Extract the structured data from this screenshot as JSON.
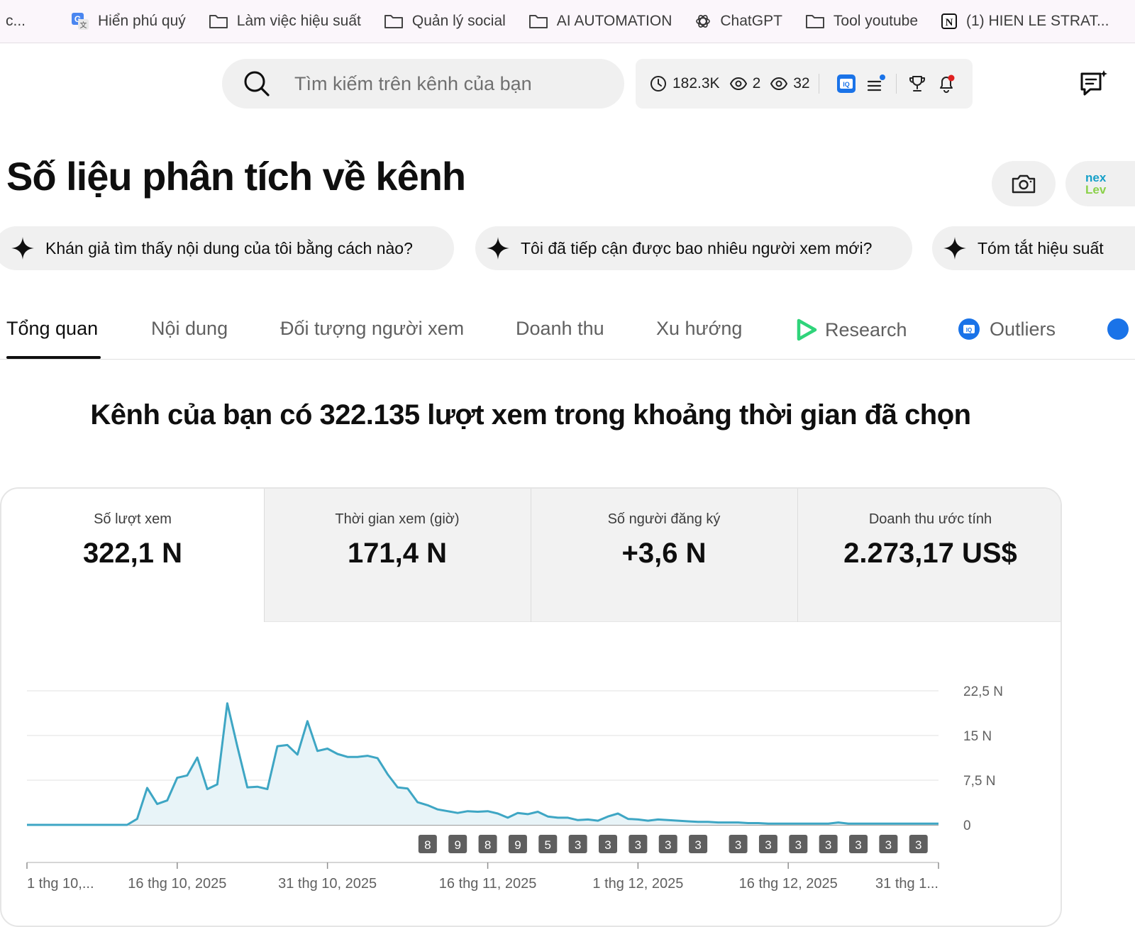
{
  "bookmarks": [
    {
      "label": "c...",
      "icon": "none"
    },
    {
      "label": "Hiển phú quý",
      "icon": "translate-icon"
    },
    {
      "label": "Làm việc hiệu suất",
      "icon": "folder-icon"
    },
    {
      "label": "Quản lý social",
      "icon": "folder-icon"
    },
    {
      "label": "AI AUTOMATION",
      "icon": "folder-icon"
    },
    {
      "label": "ChatGPT",
      "icon": "chatgpt-icon"
    },
    {
      "label": "Tool youtube",
      "icon": "folder-icon"
    },
    {
      "label": "(1) HIEN LE STRAT...",
      "icon": "notion-icon"
    }
  ],
  "search": {
    "placeholder": "Tìm kiếm trên kênh của bạn"
  },
  "extension_bar": {
    "watch_time": "182.3K",
    "views_a": "2",
    "views_b": "32"
  },
  "page": {
    "title": "Số liệu phân tích về kênh"
  },
  "suggestions": [
    "Khán giả tìm thấy nội dung của tôi bằng cách nào?",
    "Tôi đã tiếp cận được bao nhiêu người xem mới?",
    "Tóm tắt hiệu suất"
  ],
  "tabs": [
    "Tổng quan",
    "Nội dung",
    "Đối tượng người xem",
    "Doanh thu",
    "Xu hướng",
    "Research",
    "Outliers"
  ],
  "headline": "Kênh của bạn có 322.135 lượt xem trong khoảng thời gian đã chọn",
  "metrics": [
    {
      "label": "Số lượt xem",
      "value": "322,1 N"
    },
    {
      "label": "Thời gian xem (giờ)",
      "value": "171,4 N"
    },
    {
      "label": "Số người đăng ký",
      "value": "+3,6 N"
    },
    {
      "label": "Doanh thu ước tính",
      "value": "2.273,17 US$"
    }
  ],
  "colors": {
    "line": "#3ea6c4",
    "fill": "#e8f4f8",
    "accent": "#0f0f0f"
  },
  "chart_data": {
    "type": "area",
    "y_ticks": [
      "22,5 N",
      "15 N",
      "7,5 N",
      "0"
    ],
    "y_tick_values": [
      22500,
      15000,
      7500,
      0
    ],
    "ylim": [
      0,
      22500
    ],
    "x_ticks": [
      "1 thg 10,...",
      "16 thg 10, 2025",
      "31 thg 10, 2025",
      "16 thg 11, 2025",
      "1 thg 12, 2025",
      "16 thg 12, 2025",
      "31 thg 1..."
    ],
    "x_tick_days": [
      0,
      15,
      30,
      46,
      61,
      76,
      91
    ],
    "days": [
      0,
      1,
      2,
      3,
      4,
      5,
      6,
      7,
      8,
      9,
      10,
      11,
      12,
      13,
      14,
      15,
      16,
      17,
      18,
      19,
      20,
      21,
      22,
      23,
      24,
      25,
      26,
      27,
      28,
      29,
      30,
      31,
      32,
      33,
      34,
      35,
      36,
      37,
      38,
      39,
      40,
      41,
      42,
      43,
      44,
      45,
      46,
      47,
      48,
      49,
      50,
      51,
      52,
      53,
      54,
      55,
      56,
      57,
      58,
      59,
      60,
      61,
      62,
      63,
      64,
      65,
      66,
      67,
      68,
      69,
      70,
      71,
      72,
      73,
      74,
      75,
      76,
      77,
      78,
      79,
      80,
      81,
      82,
      83,
      84,
      85,
      86,
      87,
      88,
      89,
      90,
      91
    ],
    "values": [
      0,
      0,
      0,
      0,
      0,
      0,
      0,
      0,
      0,
      0,
      0,
      1000,
      6200,
      3500,
      4100,
      7900,
      8300,
      11300,
      6000,
      6800,
      20400,
      13200,
      6300,
      6400,
      6000,
      13200,
      13400,
      11800,
      17400,
      12400,
      12800,
      11900,
      11400,
      11400,
      11600,
      11200,
      8500,
      6300,
      6100,
      3800,
      3300,
      2600,
      2300,
      2000,
      2300,
      2200,
      2300,
      1900,
      1200,
      2000,
      1800,
      2200,
      1400,
      1200,
      1200,
      800,
      900,
      700,
      1400,
      1900,
      1000,
      900,
      700,
      900,
      800,
      700,
      600,
      500,
      500,
      400,
      400,
      400,
      300,
      300,
      200,
      200,
      200,
      200,
      200,
      200,
      200,
      400,
      200,
      200,
      200,
      200,
      200,
      200,
      200,
      200,
      200,
      200
    ],
    "markers": [
      {
        "day": 40,
        "label": "8"
      },
      {
        "day": 43,
        "label": "9"
      },
      {
        "day": 46,
        "label": "8"
      },
      {
        "day": 49,
        "label": "9"
      },
      {
        "day": 52,
        "label": "5"
      },
      {
        "day": 55,
        "label": "3"
      },
      {
        "day": 58,
        "label": "3"
      },
      {
        "day": 61,
        "label": "3"
      },
      {
        "day": 64,
        "label": "3"
      },
      {
        "day": 67,
        "label": "3"
      },
      {
        "day": 71,
        "label": "3"
      },
      {
        "day": 74,
        "label": "3"
      },
      {
        "day": 77,
        "label": "3"
      },
      {
        "day": 80,
        "label": "3"
      },
      {
        "day": 83,
        "label": "3"
      },
      {
        "day": 86,
        "label": "3"
      },
      {
        "day": 89,
        "label": "3"
      }
    ]
  }
}
